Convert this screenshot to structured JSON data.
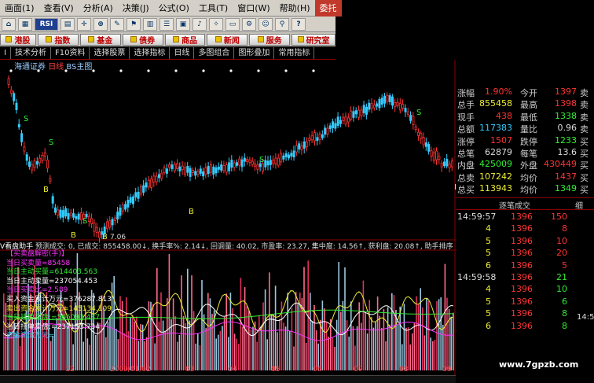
{
  "menubar": {
    "items": [
      {
        "label": "画面(1)"
      },
      {
        "label": "查看(V)"
      },
      {
        "label": "分析(A)"
      },
      {
        "label": "决策(J)"
      },
      {
        "label": "公式(O)"
      },
      {
        "label": "工具(T)"
      },
      {
        "label": "窗口(W)"
      },
      {
        "label": "帮助(H)"
      },
      {
        "label": "委托"
      }
    ]
  },
  "toolbar": {
    "rsi_label": "RSI"
  },
  "navrow": {
    "buttons": [
      {
        "label": "港股"
      },
      {
        "label": "指数"
      },
      {
        "label": "基金"
      },
      {
        "label": "债券"
      },
      {
        "label": "商品"
      },
      {
        "label": "新闻"
      },
      {
        "label": "服务"
      },
      {
        "label": "研究室"
      }
    ]
  },
  "tabs": [
    {
      "label": "Ⅰ"
    },
    {
      "label": "技术分析"
    },
    {
      "label": "F10资料"
    },
    {
      "label": "选择股票"
    },
    {
      "label": "选择指标"
    },
    {
      "label": "日线"
    },
    {
      "label": "多图组合"
    },
    {
      "label": "图形叠加"
    },
    {
      "label": "常用指标"
    }
  ],
  "chart": {
    "title_stock": "海通证券",
    "title_period": "日线",
    "title_indicator": "BS主图",
    "low_label": "7.06",
    "signals": {
      "S": "S",
      "B": "B"
    },
    "indicator_bar": {
      "name": "V看盘助手",
      "text": "预测成交: 0, 已成交: 855458.00↓, 换手率%: 2.14↓, 回调量: 40.02, 市盈率: 23.27, 集中度: 14.56↑, 获利盘: 20.08↑, 助手排序"
    },
    "side_labels": [
      {
        "label": "【买卖盘解密(手)】",
        "color": "#f3f"
      },
      {
        "label": "当日买卖量=85458",
        "color": "#f3f"
      },
      {
        "label": "当日主动买量=614403.563",
        "color": "#3e3"
      },
      {
        "label": "当日主动卖量=237054.453",
        "color": "#fff"
      },
      {
        "label": "当日买卖比=2.589",
        "color": "#f3f"
      },
      {
        "label": "买入资金累计万元=376287.813",
        "color": "#fff"
      },
      {
        "label": "卖出资金累计万元=145134.109",
        "color": "#ee3"
      },
      {
        "label": "当日挂单买盘:=566093.437",
        "color": "#3e3"
      },
      {
        "label": "当日挂单卖盘:=237153.734",
        "color": "#fff"
      },
      {
        "label": "资金流出万元=",
        "color": "#3cf"
      }
    ],
    "dates": [
      "12",
      "2009/01/02",
      "03",
      "04",
      "05",
      "06",
      "07",
      "08",
      "09"
    ]
  },
  "quote": {
    "rows": [
      {
        "l1": "涨幅",
        "v1": "1.90%",
        "c1": "#f33",
        "l2": "今开",
        "v2": "1397",
        "c2": "#f33"
      },
      {
        "l1": "总手",
        "v1": "855458",
        "c1": "#ee3",
        "l2": "最高",
        "v2": "1398",
        "c2": "#f33"
      },
      {
        "l1": "现手",
        "v1": "438",
        "c1": "#f33",
        "l2": "最低",
        "v2": "1338",
        "c2": "#3e3"
      },
      {
        "l1": "总额",
        "v1": "117383",
        "c1": "#3cf",
        "l2": "量比",
        "v2": "0.96",
        "c2": "#ddd"
      },
      {
        "l1": "涨停",
        "v1": "1507",
        "c1": "#f33",
        "l2": "跌停",
        "v2": "1233",
        "c2": "#3e3"
      },
      {
        "l1": "总笔",
        "v1": "62879",
        "c1": "#ddd",
        "l2": "每笔",
        "v2": "13.6",
        "c2": "#ddd"
      },
      {
        "l1": "内盘",
        "v1": "425009",
        "c1": "#3e3",
        "l2": "外盘",
        "v2": "430449",
        "c2": "#f33"
      },
      {
        "l1": "总卖",
        "v1": "107242",
        "c1": "#ee3",
        "l2": "均价",
        "v2": "1437",
        "c2": "#f33"
      },
      {
        "l1": "总买",
        "v1": "113943",
        "c1": "#ee3",
        "l2": "均价",
        "v2": "1349",
        "c2": "#3e3"
      }
    ],
    "right_edge": [
      "卖",
      "卖",
      "卖",
      "卖",
      "买",
      "买",
      "买",
      "买",
      "买"
    ],
    "tick_header": "逐笔成交",
    "tick_header_right": "细",
    "ticks": [
      {
        "time": "14:59:57",
        "price": "1396",
        "vol": "150",
        "vc": "#f33"
      },
      {
        "time": "",
        "type": "4",
        "price": "1396",
        "vol": "8",
        "vc": "#f33"
      },
      {
        "time": "",
        "type": "5",
        "price": "1396",
        "vol": "10",
        "vc": "#f33"
      },
      {
        "time": "",
        "type": "5",
        "price": "1396",
        "vol": "20",
        "vc": "#f33"
      },
      {
        "time": "",
        "type": "6",
        "price": "1396",
        "vol": "5",
        "vc": "#f33"
      },
      {
        "time": "14:59:58",
        "price": "1396",
        "vol": "21",
        "vc": "#3e3"
      },
      {
        "time": "",
        "type": "4",
        "price": "1396",
        "vol": "10",
        "vc": "#3e3"
      },
      {
        "time": "",
        "type": "5",
        "price": "1396",
        "vol": "6",
        "vc": "#3e3"
      },
      {
        "time": "",
        "type": "5",
        "price": "1396",
        "vol": "8",
        "vc": "#3e3"
      },
      {
        "time": "",
        "type": "6",
        "price": "1396",
        "vol": "8",
        "vc": "#3e3"
      }
    ],
    "edge_time": "14:5"
  },
  "watermark": "www.7gpzb.com"
}
